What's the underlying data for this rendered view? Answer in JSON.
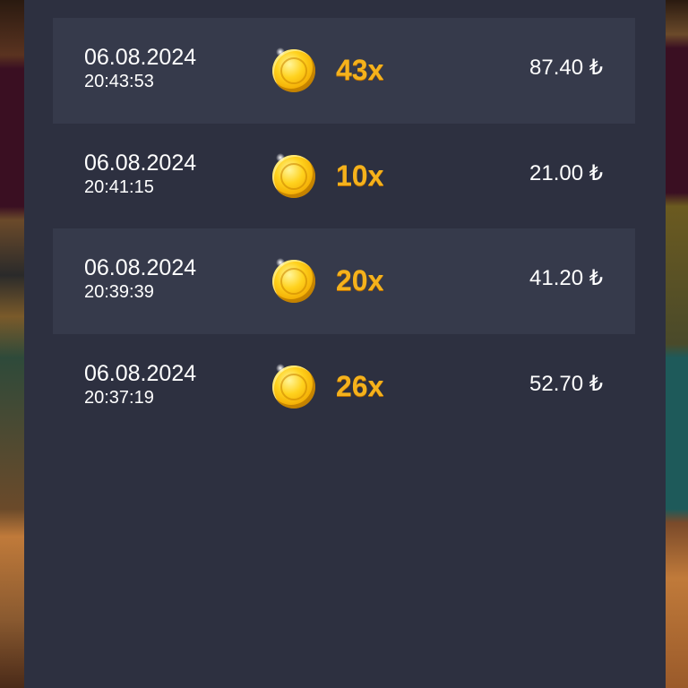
{
  "history": {
    "rows": [
      {
        "date": "06.08.2024",
        "time": "20:43:53",
        "icon": "gold-coin-icon",
        "multiplier": "43x",
        "amount": "87.40 ₺"
      },
      {
        "date": "06.08.2024",
        "time": "20:41:15",
        "icon": "gold-coin-icon",
        "multiplier": "10x",
        "amount": "21.00 ₺"
      },
      {
        "date": "06.08.2024",
        "time": "20:39:39",
        "icon": "gold-coin-icon",
        "multiplier": "20x",
        "amount": "41.20 ₺"
      },
      {
        "date": "06.08.2024",
        "time": "20:37:19",
        "icon": "gold-coin-icon",
        "multiplier": "26x",
        "amount": "52.70 ₺"
      }
    ]
  },
  "colors": {
    "panel": "#2d3040",
    "row_shaded": "#363a4b",
    "multiplier": "#f5b21c",
    "text": "#ffffff"
  }
}
